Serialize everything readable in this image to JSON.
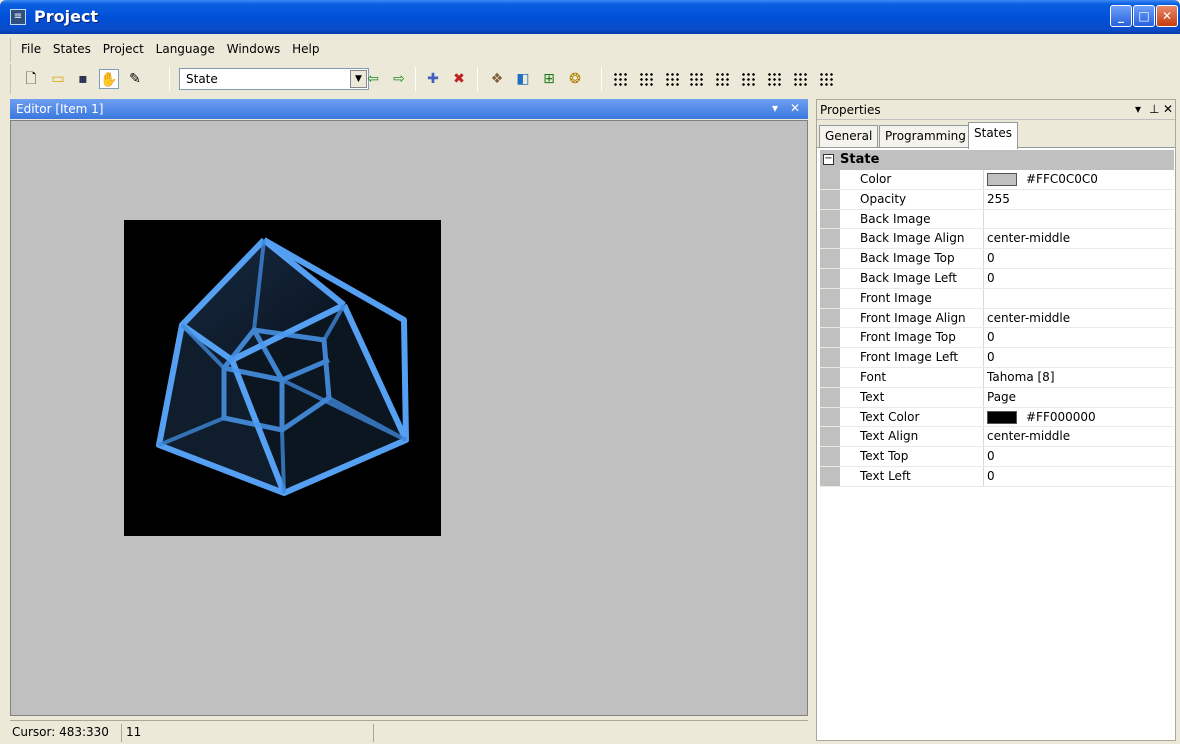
{
  "window": {
    "title": "Project"
  },
  "menu": [
    "File",
    "States",
    "Project",
    "Language",
    "Windows",
    "Help"
  ],
  "toolbar": {
    "state_combo_value": "State",
    "icons": [
      "new-file-icon",
      "open-folder-icon",
      "save-icon",
      "hand-icon",
      "pencil-icon",
      "combo-dropdown",
      "arrow-left-icon",
      "arrow-right-icon",
      "add-icon",
      "delete-icon",
      "bring-icon",
      "paint-icon",
      "fit-icon",
      "sprite-icon"
    ]
  },
  "editor": {
    "title": "Editor [Item 1]"
  },
  "status": {
    "cursor": "Cursor: 483:330",
    "value": "11"
  },
  "properties": {
    "title": "Properties",
    "tabs": [
      "General",
      "Programming",
      "States"
    ],
    "category": "State",
    "rows": [
      {
        "name": "Color",
        "value": "#FFC0C0C0",
        "swatch": "#c0c0c0"
      },
      {
        "name": "Opacity",
        "value": "255"
      },
      {
        "name": "Back Image",
        "value": ""
      },
      {
        "name": "Back Image Align",
        "value": "center-middle"
      },
      {
        "name": "Back Image Top",
        "value": "0"
      },
      {
        "name": "Back Image Left",
        "value": "0"
      },
      {
        "name": "Front Image",
        "value": ""
      },
      {
        "name": "Front Image Align",
        "value": "center-middle"
      },
      {
        "name": "Front Image Top",
        "value": "0"
      },
      {
        "name": "Front Image Left",
        "value": "0"
      },
      {
        "name": "Font",
        "value": "Tahoma [8]"
      },
      {
        "name": "Text",
        "value": "Page"
      },
      {
        "name": "Text Color",
        "value": "#FF000000",
        "swatch": "#000000"
      },
      {
        "name": "Text Align",
        "value": "center-middle"
      },
      {
        "name": "Text Top",
        "value": "0"
      },
      {
        "name": "Text Left",
        "value": "0"
      }
    ]
  },
  "colors": {
    "titlebar": "#0050d8",
    "canvas": "#c0c0c0",
    "cube_edge": "#5aa8ff"
  }
}
